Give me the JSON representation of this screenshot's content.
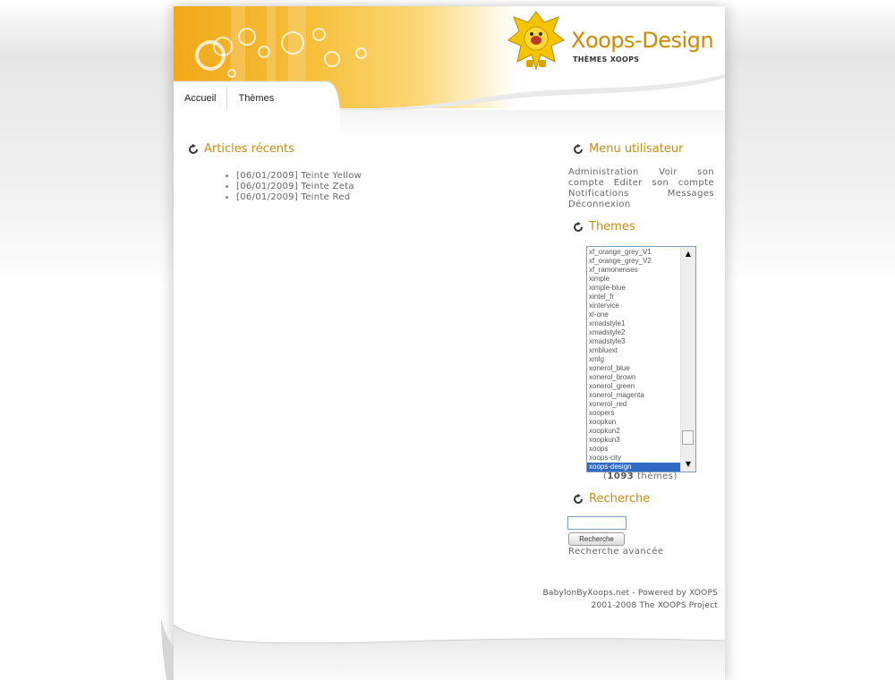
{
  "logo": {
    "title": "Xoops-Design",
    "subtitle": "THÈMES XOOPS"
  },
  "nav": {
    "items": [
      {
        "label": "Accueil"
      },
      {
        "label": "Thèmes"
      }
    ]
  },
  "articles": {
    "title": "Articles récents",
    "items": [
      "[06/01/2009] Teinte Yellow",
      "[06/01/2009] Teinte Zeta",
      "[06/01/2009] Teinte Red"
    ]
  },
  "user_menu": {
    "title": "Menu utilisateur",
    "links": [
      "Administration",
      "Voir son compte",
      "Editer son compte",
      "Notifications",
      "Messages",
      "Déconnexion"
    ]
  },
  "themes": {
    "title": "Themes",
    "options": [
      "xf_orange_grey_V1",
      "xf_orange_grey_V2",
      "xf_ramonenses",
      "ximple",
      "ximple-blue",
      "xintel_fr",
      "xintervice",
      "xl-one",
      "xmadstyle1",
      "xmadstyle2",
      "xmadstyle3",
      "xmbluext",
      "xmlg",
      "xonerol_blue",
      "xonerol_brown",
      "xonerol_green",
      "xonerol_magenta",
      "xonerol_red",
      "xoopers",
      "xoopkun",
      "xoopkun2",
      "xoopkun3",
      "xoops",
      "xoops-city",
      "xoops-design"
    ],
    "selected": "xoops-design",
    "count_open": "(",
    "count": "1093",
    "count_suffix": "thèmes)"
  },
  "search": {
    "title": "Recherche",
    "input_value": "",
    "button_label": "Recherche",
    "advanced_label": "Recherche avancée"
  },
  "footer": {
    "line1": "BabylonByXoops.net - Powered by XOOPS",
    "line2": "2001-2008 The XOOPS Project"
  },
  "colors": {
    "accent": "#c98b12",
    "header_orange": "#f1a91a",
    "selection": "#316ac5"
  }
}
